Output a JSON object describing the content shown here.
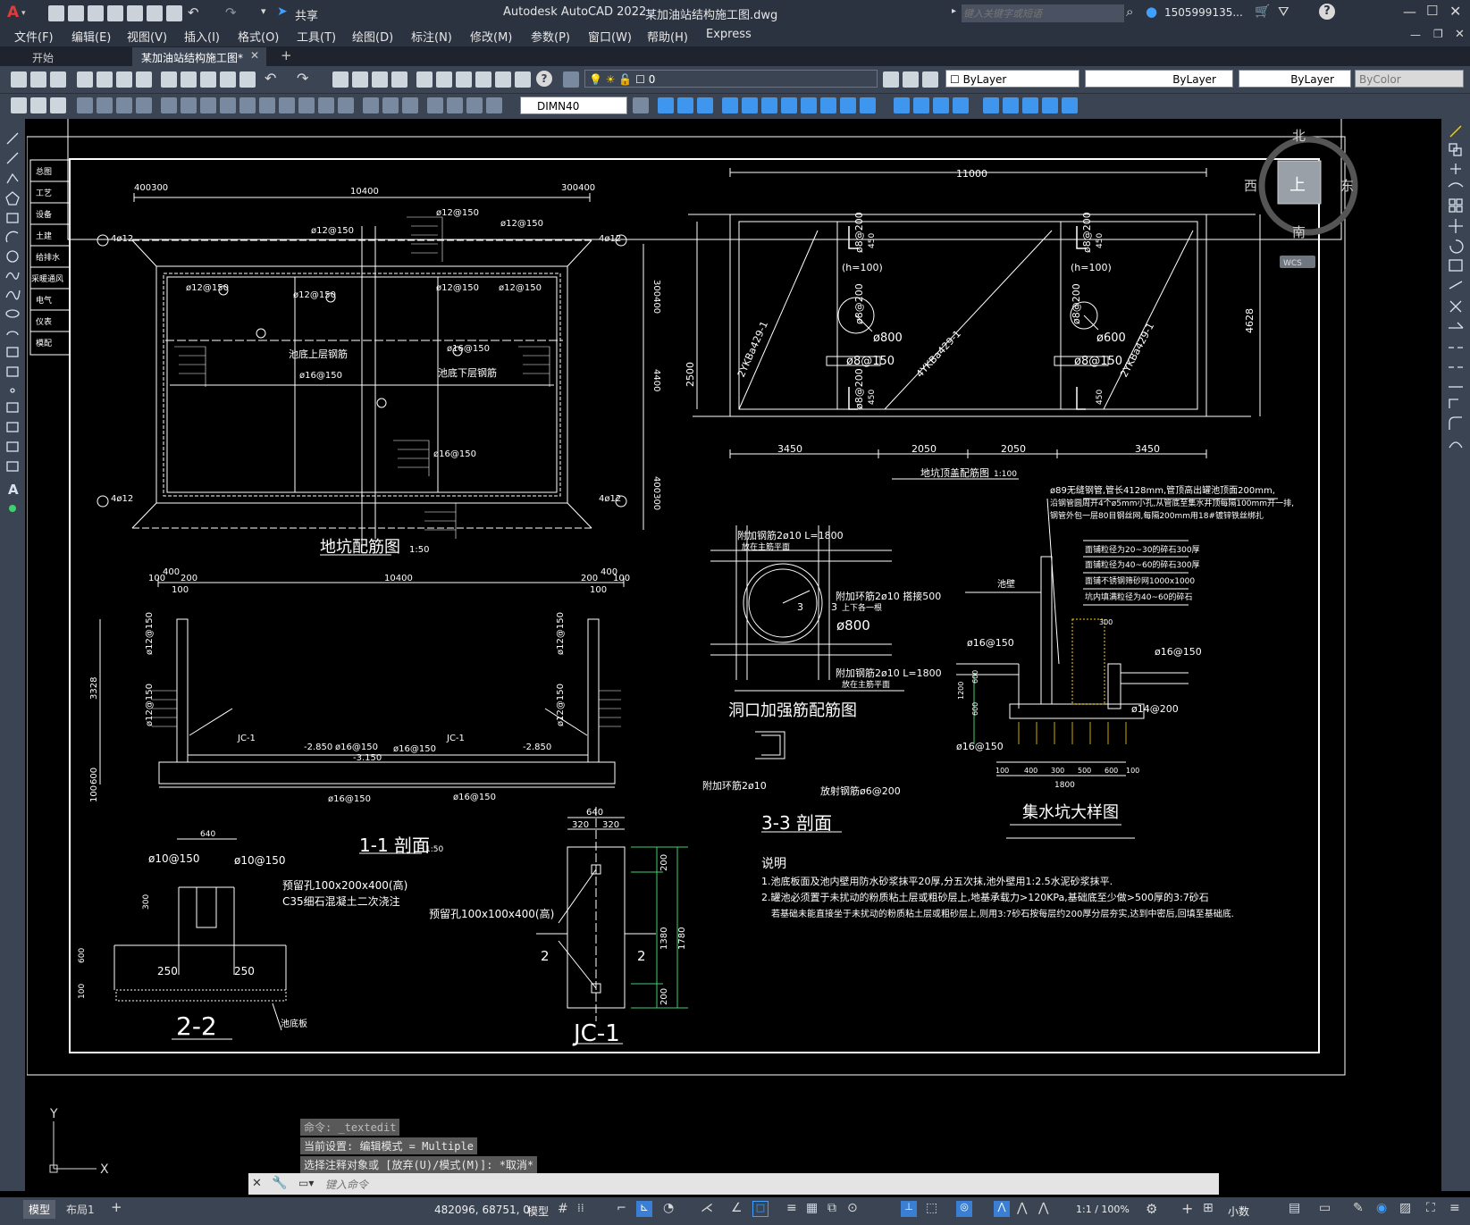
{
  "app": {
    "logo": "A",
    "title": "Autodesk AutoCAD 2022",
    "filename": "某加油站结构施工图.dwg",
    "share_label": "共享",
    "search_placeholder": "键入关键字或短语",
    "user": "1505999135...",
    "help_icon": "?"
  },
  "menus": [
    "文件(F)",
    "编辑(E)",
    "视图(V)",
    "插入(I)",
    "格式(O)",
    "工具(T)",
    "绘图(D)",
    "标注(N)",
    "修改(M)",
    "参数(P)",
    "窗口(W)",
    "帮助(H)",
    "Express"
  ],
  "tabs": {
    "home": "开始",
    "active": "某加油站结构施工图*",
    "close": "✕",
    "add": "+"
  },
  "toolbar": {
    "layer_value": "0",
    "color": "ByLayer",
    "linetype": "ByLayer",
    "lineweight": "ByLayer",
    "plotstyle": "ByColor",
    "dimstyle": "DIMN40"
  },
  "viewcube": {
    "north": "北",
    "south": "南",
    "east": "东",
    "west": "西",
    "top": "上",
    "wcs": "WCS"
  },
  "sidebar_labels": [
    "总图",
    "工艺",
    "设备",
    "土建",
    "给排水",
    "采暖通风",
    "电气",
    "仪表",
    "模配"
  ],
  "ucs": {
    "y": "Y",
    "x": "X"
  },
  "command": {
    "history": [
      "命令: _textedit",
      "当前设置: 编辑模式 = Multiple",
      "选择注释对象或 [放弃(U)/模式(M)]: *取消*"
    ],
    "placeholder": "键入命令"
  },
  "layout_tabs": [
    "模型",
    "布局1",
    "+"
  ],
  "status": {
    "coords": "482096, 68751, 0",
    "model": "模型",
    "scale": "1:1 / 100%",
    "units": "小数"
  },
  "drawing": {
    "pit_plan": {
      "title": "地坑配筋图",
      "scale": "1:50",
      "upper": "池底上层钢筋",
      "lower": "池底下层钢筋",
      "dim_top": "10400",
      "dim_left": "400300",
      "dim_right": "300400",
      "labels": [
        "ø12@150",
        "ø12@150",
        "ø12@150",
        "ø12@150",
        "ø12@150",
        "ø12@150",
        "ø12@150",
        "ø16@150",
        "ø16@150",
        "ø16@150",
        "4ø12",
        "4ø12",
        "4ø12",
        "4ø12",
        "300400",
        "400300",
        "4400"
      ]
    },
    "roof_plan": {
      "title": "地坑顶盖配筋图",
      "scale": "1:100",
      "dims_bottom": [
        "3450",
        "2050",
        "2050",
        "3450"
      ],
      "dim_top": "11000",
      "dim_right": "4628",
      "dim_left": "2500",
      "labels": [
        "2YKBa429-1",
        "4YKBa429-1",
        "2YKBa429-1",
        "ø800",
        "ø600",
        "ø8@150",
        "ø8@150",
        "ø8@200",
        "ø8@200",
        "ø8@200",
        "ø8@200",
        "ø8@200",
        "(h=100)",
        "(h=100)",
        "450",
        "450",
        "450",
        "450"
      ]
    },
    "section11": {
      "title": "1-1 剖面",
      "scale": "1:50",
      "dim_top": "10400",
      "left_dims": [
        "100",
        "400",
        "200",
        "100"
      ],
      "right_dims": [
        "200",
        "400",
        "100",
        "100"
      ],
      "height": "3328",
      "labels": [
        "JC-1",
        "JC-1",
        "-2.850",
        "-2.850",
        "-3.150",
        "ø16@150",
        "ø16@150",
        "ø16@150",
        "ø16@150",
        "ø12@150",
        "ø12@150",
        "ø12@150",
        "ø12@150",
        "600",
        "100"
      ]
    },
    "opening": {
      "title": "洞口加强筋配筋图",
      "notes": [
        "附加钢筋2ø10 L=1800",
        "放在主筋平面",
        "附加环筋2ø10 搭接500",
        "上下各一根",
        "ø800",
        "附加钢筋2ø10 L=1800",
        "放在主筋平面",
        "3",
        "3"
      ]
    },
    "section33": {
      "title": "3-3 剖面",
      "notes": [
        "附加环筋2ø10",
        "放射钢筋ø6@200"
      ]
    },
    "sump": {
      "title": "集水坑大样图",
      "notes": [
        "ø89无缝钢管,管长4128mm,管顶高出罐池顶面200mm,",
        "沿钢管圆周开4个ø5mm小孔,从管底至集水井顶每隔100mm开一排,",
        "钢管外包一层80目钢丝网,每隔200mm用18#镀锌铁丝绑扎",
        "面铺粒径为20~30的碎石300厚",
        "面铺粒径为40~60的碎石300厚",
        "面铺不锈钢筛砂网1000x1000",
        "坑内填满粒径为40~60的碎石",
        "池壁",
        "ø16@150",
        "ø16@150",
        "ø14@200",
        "ø16@150",
        "1800"
      ],
      "dims": [
        "100",
        "400",
        "300",
        "500",
        "600",
        "100"
      ],
      "dims_v": [
        "1200",
        "600",
        "600",
        "300"
      ]
    },
    "section22": {
      "title": "2-2",
      "notes": [
        "ø10@150",
        "ø10@150",
        "预留孔100x200x400(高)",
        "C35细石混凝土二次浇注",
        "250",
        "250",
        "池底板",
        "640",
        "300",
        "600",
        "100"
      ]
    },
    "jc1": {
      "title": "JC-1",
      "notes": [
        "640",
        "320",
        "320",
        "预留孔100x100x400(高)",
        "2",
        "2",
        "1380",
        "1780",
        "200",
        "200"
      ]
    },
    "notes": {
      "title": "说明",
      "lines": [
        "1.池底板面及池内壁用防水砂浆抹平20厚,分五次抹,池外壁用1:2.5水泥砂浆抹平.",
        "2.罐池必须置于未扰动的粉质粘土层或粗砂层上,地基承载力>120KPa,基础底至少做>500厚的3:7砂石",
        "若基础未能直接坐于未扰动的粉质粘土层或粗砂层上,则用3:7砂石按每层约200厚分层夯实,达到中密后,回填至基础底."
      ]
    }
  }
}
